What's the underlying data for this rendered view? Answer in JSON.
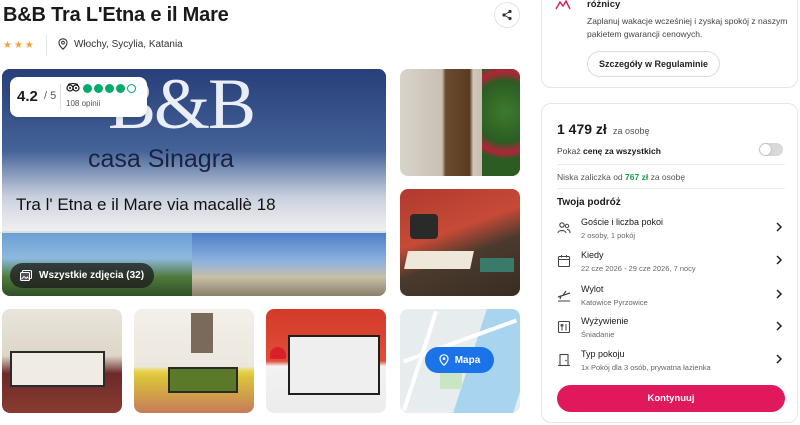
{
  "hotel": {
    "name": "B&B Tra L'Etna e il Mare",
    "stars": "★★★",
    "location": "Włochy, Sycylia, Katania"
  },
  "rating": {
    "score": "4.2",
    "max": "/ 5",
    "reviews": "108 opinii",
    "bubbles_filled": 4,
    "bubbles_total": 5
  },
  "gallery": {
    "sign_big": "B&B",
    "sign_casa": "casa Sinagra",
    "sign_street": "Tra l' Etna e il Mare  via macallè 18",
    "all_photos_label": "Wszystkie zdjęcia (32)",
    "map_label": "Mapa"
  },
  "guarantee": {
    "title": "różnicy",
    "description": "Zaplanuj wakacje wcześniej i zyskaj spokój z naszym pakietem gwarancji cenowych.",
    "details_button": "Szczegóły w Regulaminie"
  },
  "booking": {
    "price": "1 479 zł",
    "price_note": "za osobę",
    "total_label_pre": "Pokaż",
    "total_label_bold": "cenę za wszystkich",
    "deposit_pre": "Niska zaliczka od",
    "deposit_amount": "767 zł",
    "deposit_post": "za osobę",
    "trip_title": "Twoja podróż",
    "rows": [
      {
        "label": "Goście i liczba pokoi",
        "value": "2 osoby, 1 pokój"
      },
      {
        "label": "Kiedy",
        "value": "22 cze 2026 - 29 cze 2026, 7 nocy"
      },
      {
        "label": "Wylot",
        "value": "Katowice Pyrzowice"
      },
      {
        "label": "Wyżywienie",
        "value": "Śniadanie"
      },
      {
        "label": "Typ pokoju",
        "value": "1x Pokój dla 3 osób, prywatna łazienka"
      }
    ],
    "continue_button": "Kontynuuj"
  },
  "colors": {
    "accent": "#e0195c",
    "tripadvisor_green": "#00aa6c",
    "deposit_green": "#1a9e4a",
    "map_button": "#1a73e8"
  }
}
